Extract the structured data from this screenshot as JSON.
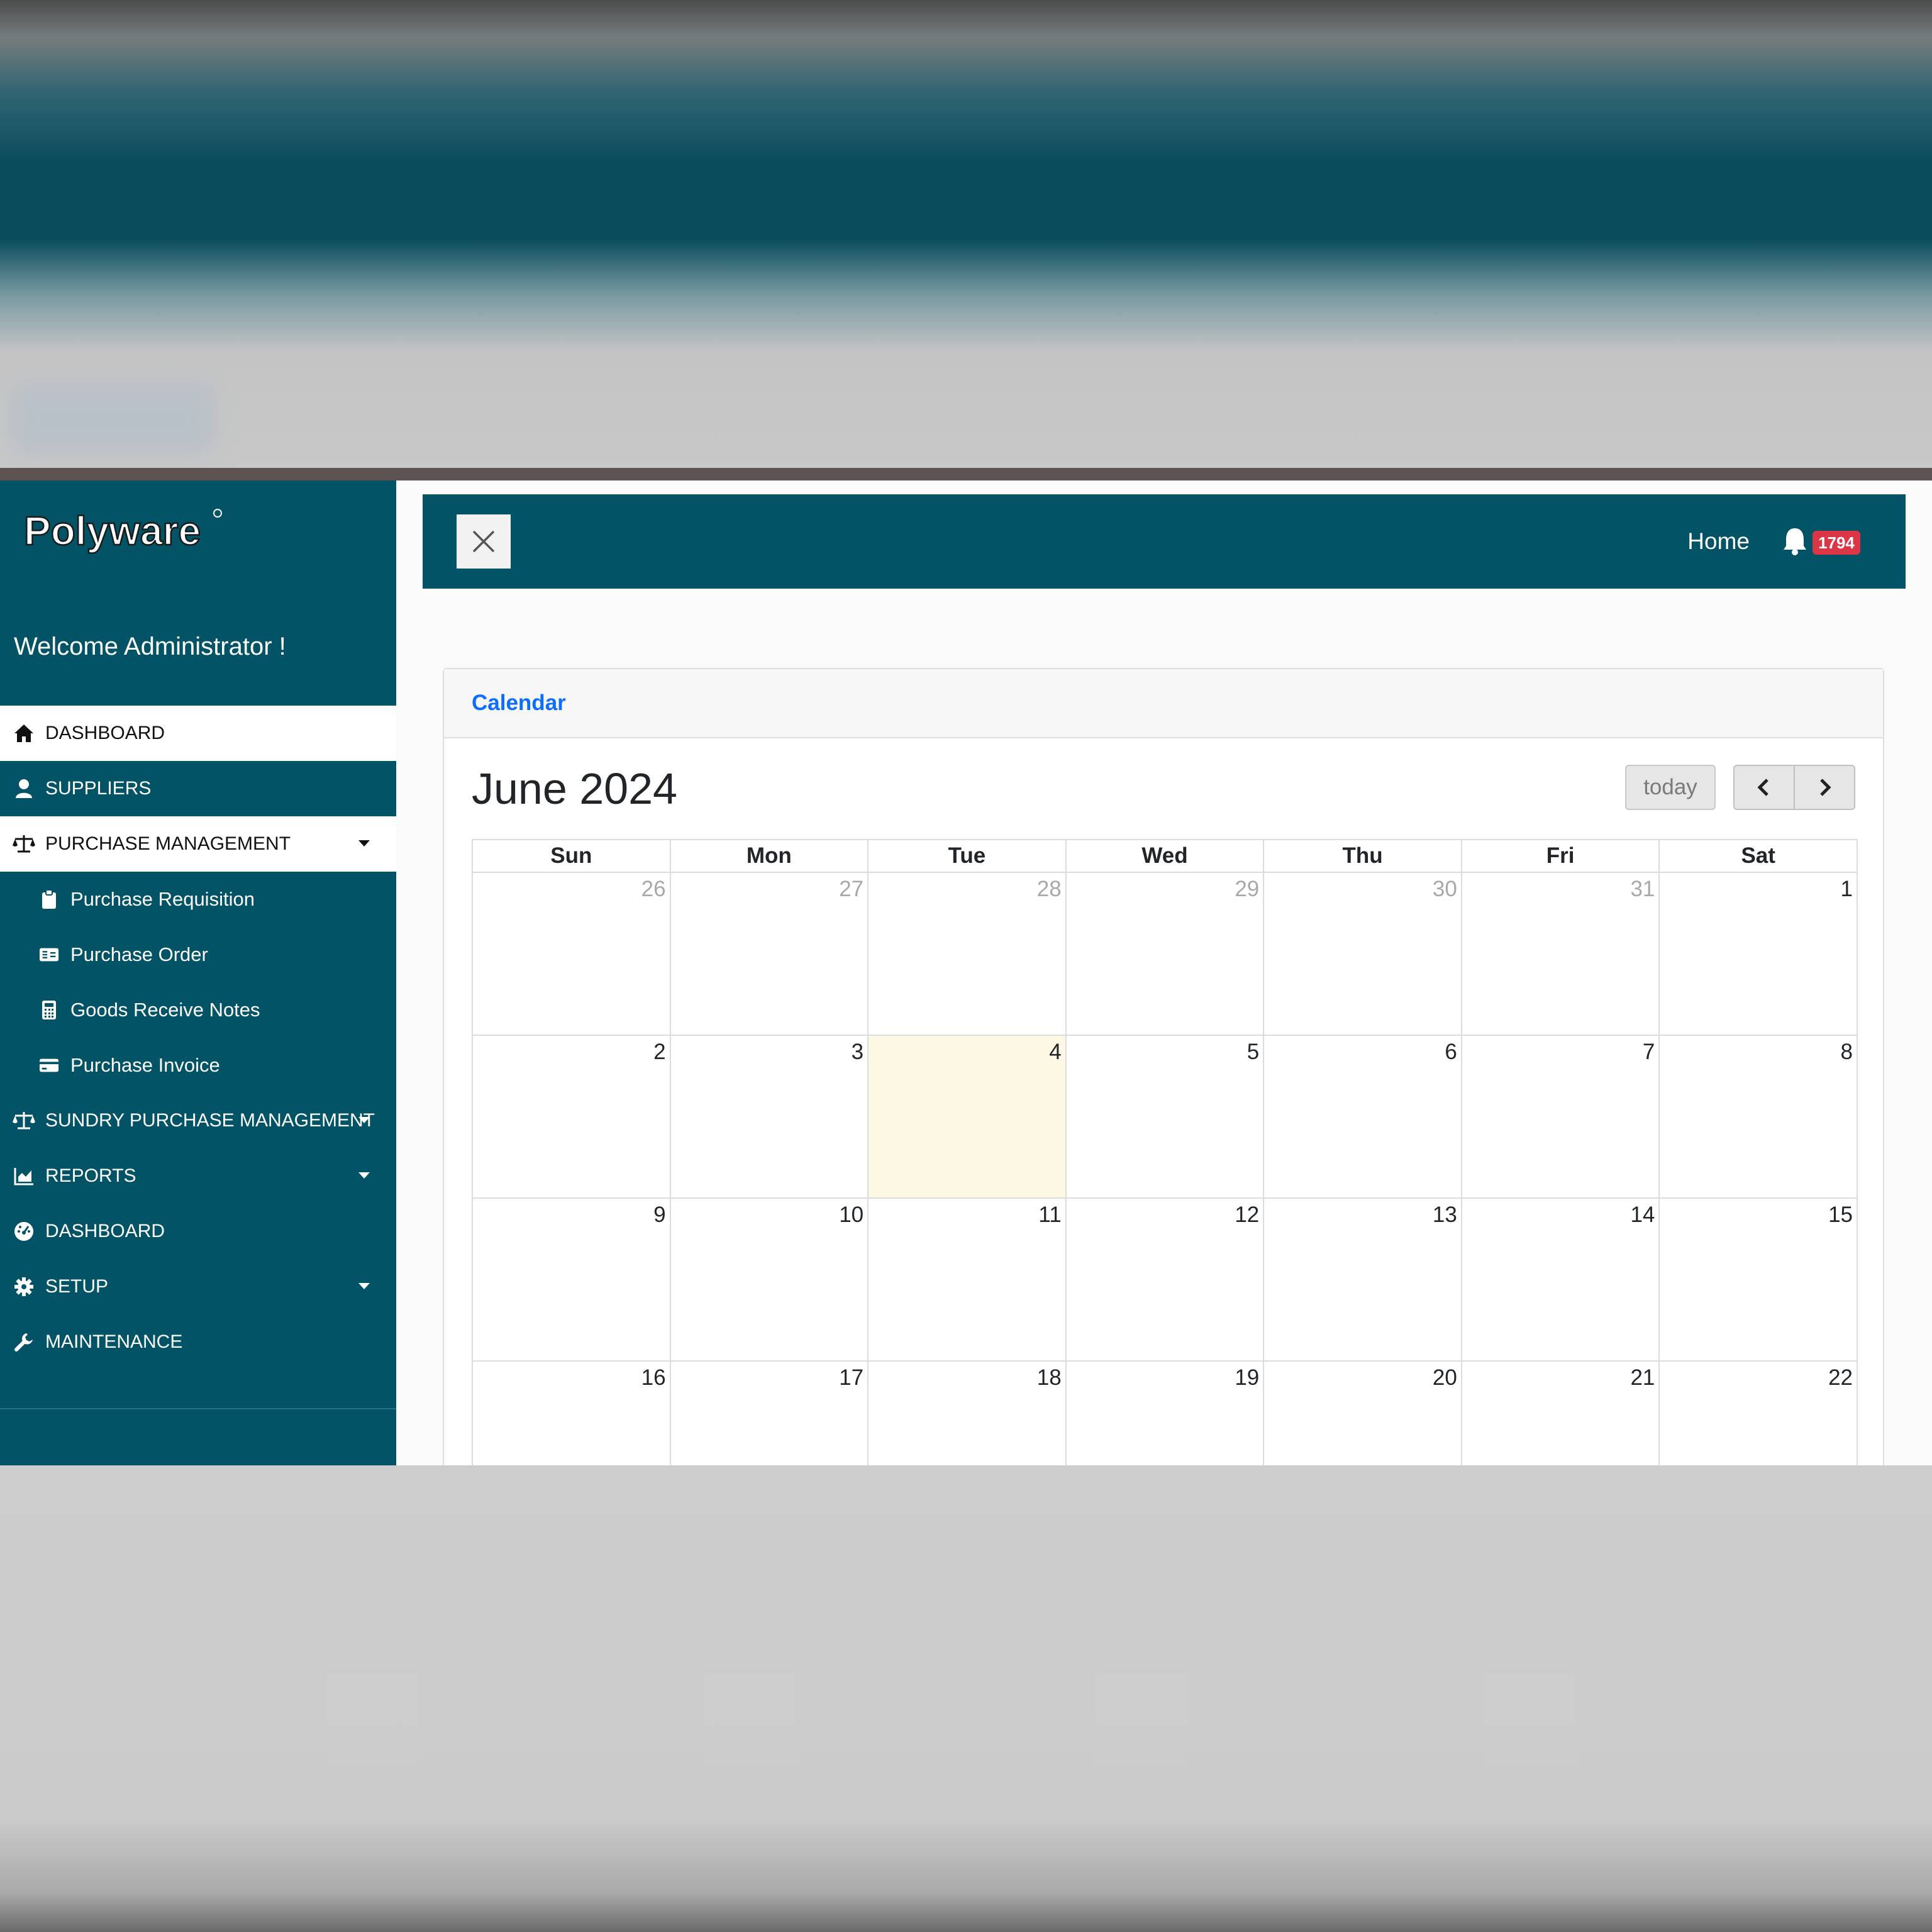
{
  "brand": {
    "logo_text": "Polyware",
    "primary_color": "#025365"
  },
  "welcome": {
    "prefix": "Welcome ",
    "name": "Administrator !"
  },
  "sidebar": {
    "items": [
      {
        "label": "DASHBOARD",
        "icon": "home-icon",
        "active": true
      },
      {
        "label": "SUPPLIERS",
        "icon": "user-icon"
      },
      {
        "label": "PURCHASE MANAGEMENT",
        "icon": "scale-icon",
        "expanded": true
      },
      {
        "label": "SUNDRY PURCHASE MANAGEMENT",
        "icon": "scale-icon"
      },
      {
        "label": "REPORTS",
        "icon": "chart-icon"
      },
      {
        "label": "DASHBOARD",
        "icon": "gauge-icon"
      },
      {
        "label": "SETUP",
        "icon": "gear-icon"
      },
      {
        "label": "MAINTENANCE",
        "icon": "wrench-icon"
      }
    ],
    "submenu": [
      {
        "label": "Purchase Requisition",
        "icon": "clipboard-icon"
      },
      {
        "label": "Purchase Order",
        "icon": "receipt-icon"
      },
      {
        "label": "Goods Receive Notes",
        "icon": "calculator-icon"
      },
      {
        "label": "Purchase Invoice",
        "icon": "credit-card-icon"
      }
    ]
  },
  "topbar": {
    "home_label": "Home",
    "notification_count": "1794",
    "badge_color": "#dc3545"
  },
  "card": {
    "title": "Calendar"
  },
  "calendar": {
    "title": "June 2024",
    "today_label": "today",
    "weekdays": [
      "Sun",
      "Mon",
      "Tue",
      "Wed",
      "Thu",
      "Fri",
      "Sat"
    ],
    "weeks": [
      [
        "26",
        "27",
        "28",
        "29",
        "30",
        "31",
        "1"
      ],
      [
        "2",
        "3",
        "4",
        "5",
        "6",
        "7",
        "8"
      ],
      [
        "9",
        "10",
        "11",
        "12",
        "13",
        "14",
        "15"
      ],
      [
        "16",
        "17",
        "18",
        "19",
        "20",
        "21",
        "22"
      ]
    ],
    "today_highlight_color": "#fcf8e3"
  }
}
